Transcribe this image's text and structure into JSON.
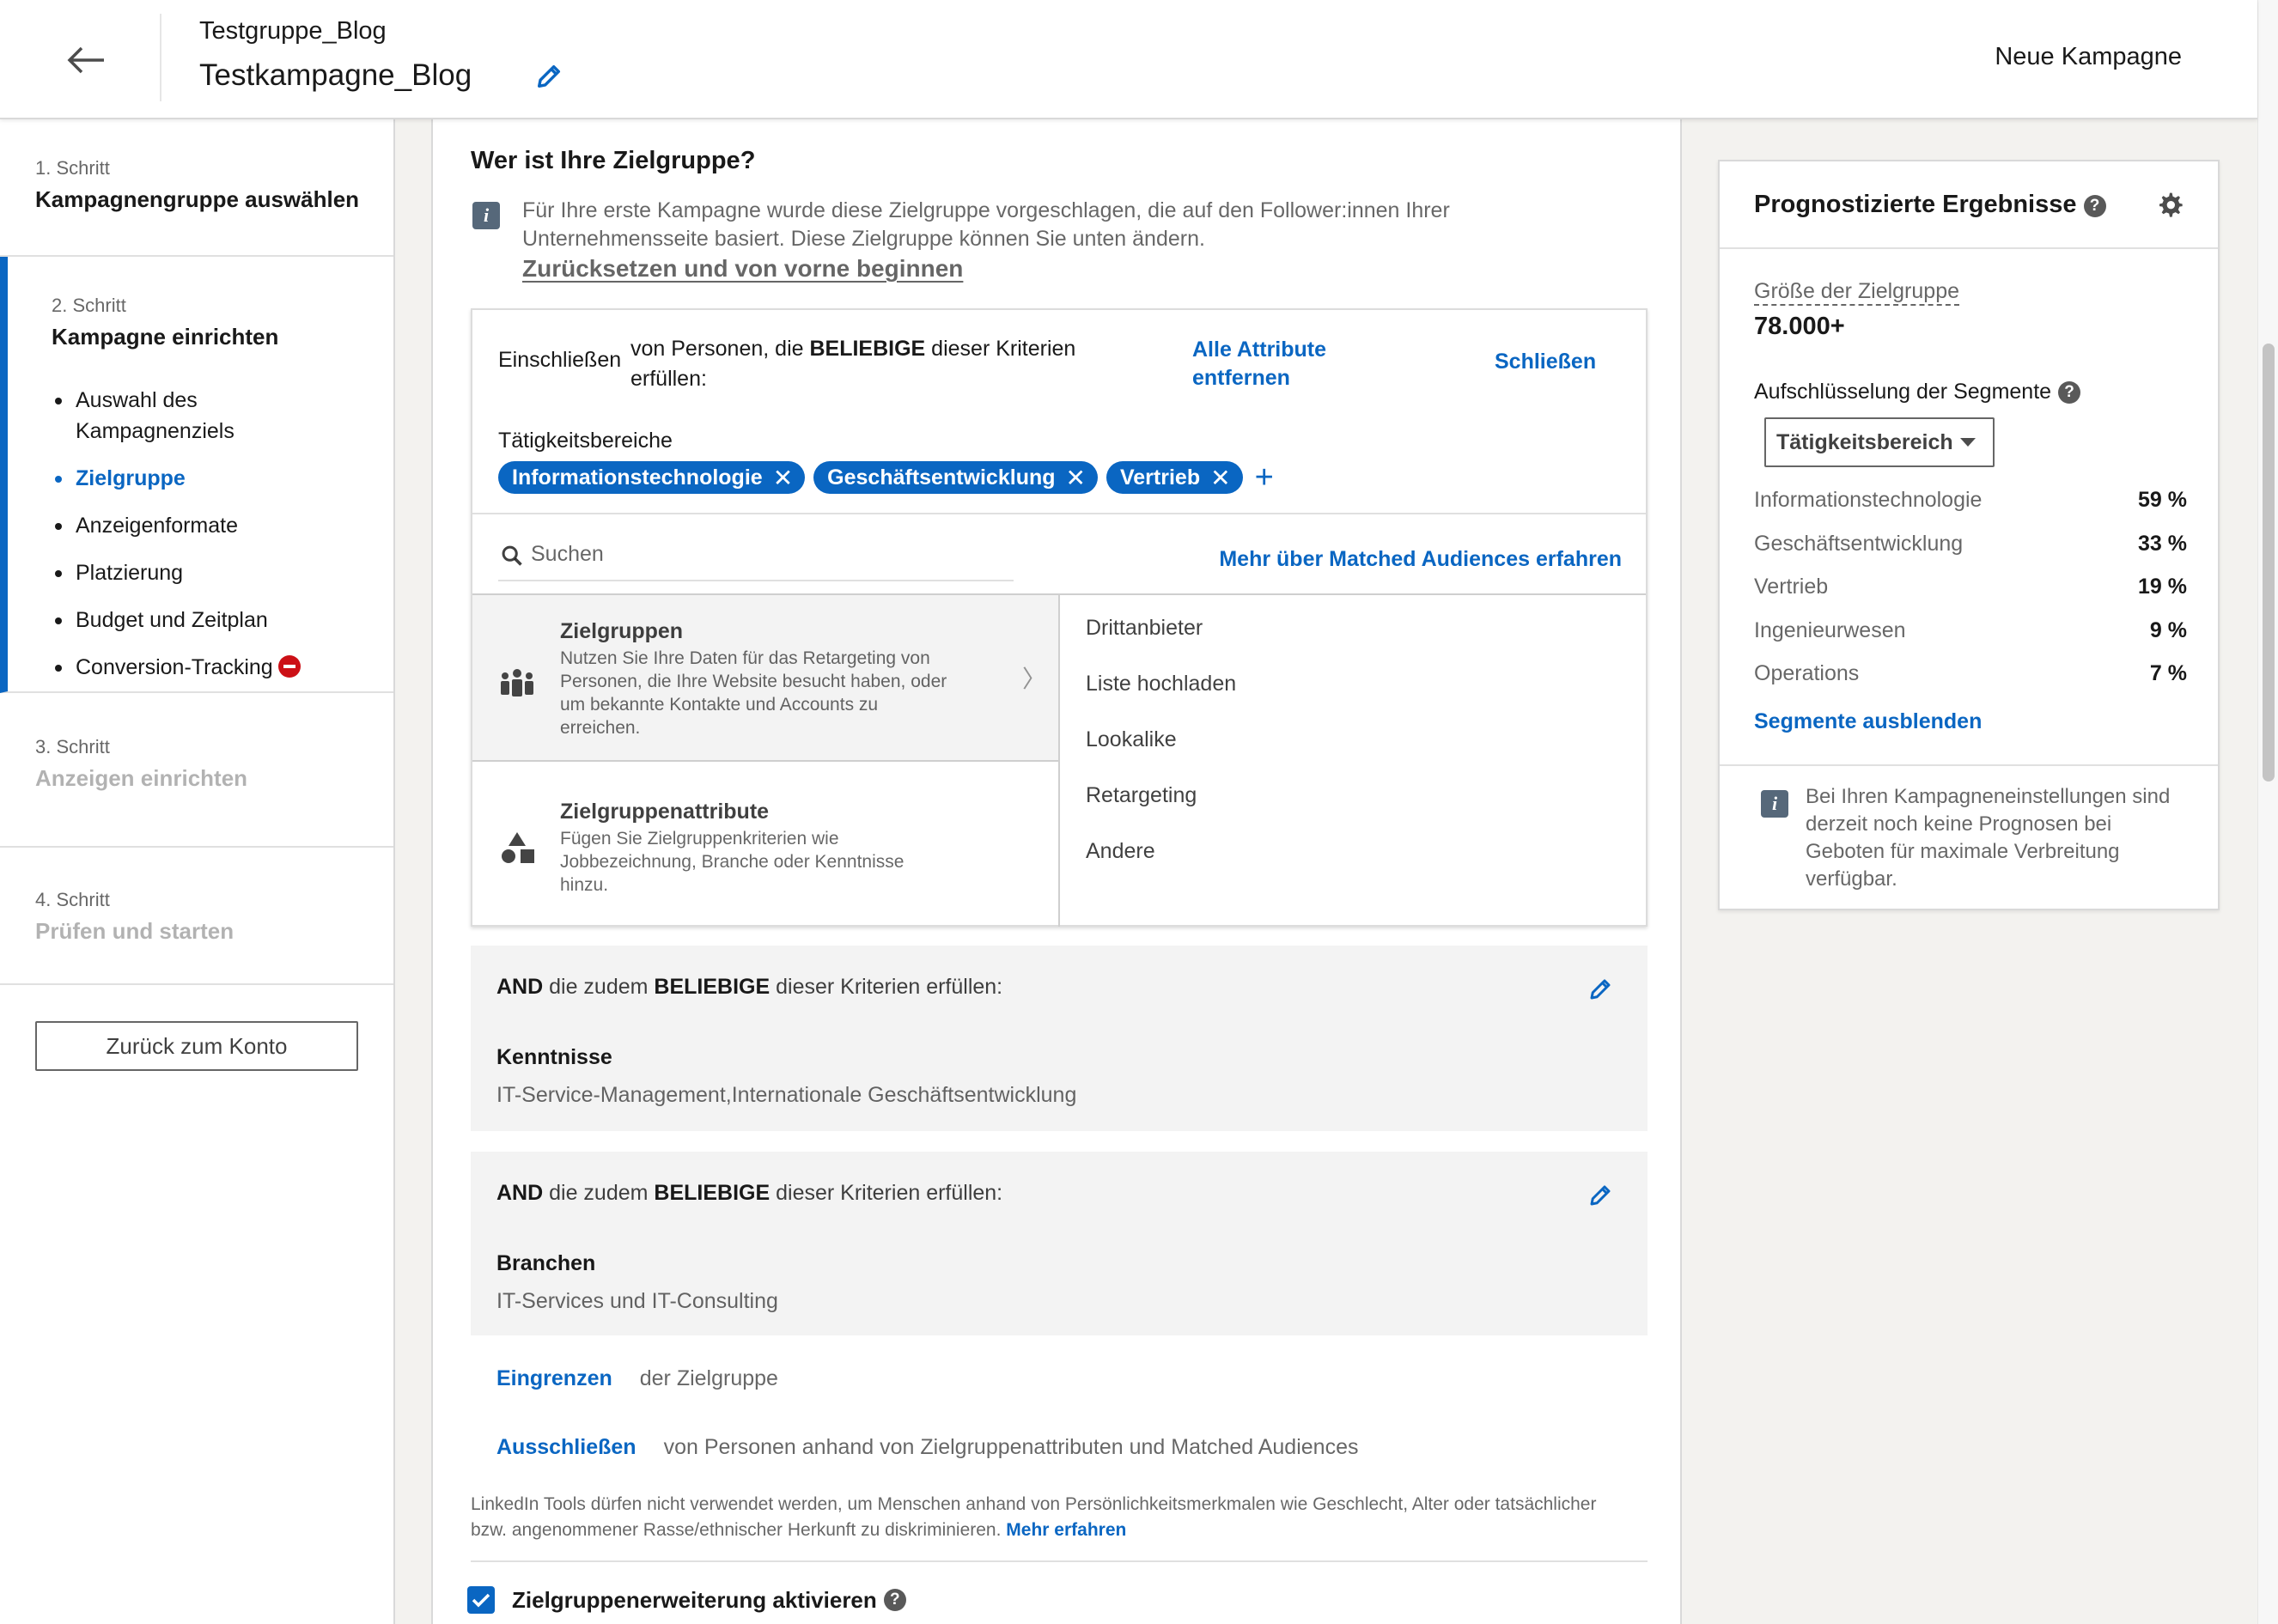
{
  "header": {
    "group_name": "Testgruppe_Blog",
    "campaign_name": "Testkampagne_Blog",
    "new_campaign": "Neue Kampagne"
  },
  "sidebar": {
    "step1": {
      "num": "1. Schritt",
      "title": "Kampagnengruppe auswählen"
    },
    "step2": {
      "num": "2. Schritt",
      "title": "Kampagne einrichten",
      "substeps": [
        "Auswahl des Kampagnenziels",
        "Zielgruppe",
        "Anzeigenformate",
        "Platzierung",
        "Budget und Zeitplan",
        "Conversion-Tracking"
      ]
    },
    "step3": {
      "num": "3. Schritt",
      "title": "Anzeigen einrichten"
    },
    "step4": {
      "num": "4. Schritt",
      "title": "Prüfen und starten"
    },
    "back_button": "Zurück zum Konto"
  },
  "main": {
    "section_title": "Wer ist Ihre Zielgruppe?",
    "info_text": "Für Ihre erste Kampagne wurde diese Zielgruppe vorgeschlagen, die auf den Follower:innen Ihrer Unternehmensseite basiert. Diese Zielgruppe können Sie unten ändern.",
    "reset_link": "Zurücksetzen und von vorne beginnen",
    "include": {
      "label": "Einschließen",
      "desc_pre": "von Personen, die ",
      "desc_bold": "BELIEBIGE",
      "desc_post": " dieser Kriterien erfüllen:",
      "remove_all": "Alle Attribute entfernen",
      "close": "Schließen",
      "category": "Tätigkeitsbereiche",
      "chips": [
        "Informationstechnologie",
        "Geschäftsentwicklung",
        "Vertrieb"
      ],
      "search_placeholder": "Suchen",
      "matched_link": "Mehr über Matched Audiences erfahren",
      "options": [
        {
          "title": "Zielgruppen",
          "desc": "Nutzen Sie Ihre Daten für das Retargeting von Personen, die Ihre Website besucht haben, oder um bekannte Kontakte und Accounts zu erreichen."
        },
        {
          "title": "Zielgruppenattribute",
          "desc": "Fügen Sie Zielgruppenkriterien wie Jobbezeichnung, Branche oder Kenntnisse hinzu."
        }
      ],
      "sub_options": [
        "Drittanbieter",
        "Liste hochladen",
        "Lookalike",
        "Retargeting",
        "Andere"
      ]
    },
    "and_blocks": [
      {
        "and": "AND",
        "mid": " die zudem ",
        "bold": "BELIEBIGE",
        "post": " dieser Kriterien erfüllen:",
        "category": "Kenntnisse",
        "value": "IT-Service-Management,Internationale Geschäftsentwicklung"
      },
      {
        "and": "AND",
        "mid": " die zudem ",
        "bold": "BELIEBIGE",
        "post": " dieser Kriterien erfüllen:",
        "category": "Branchen",
        "value": "IT-Services und IT-Consulting"
      }
    ],
    "narrow": {
      "link": "Eingrenzen",
      "text": "der Zielgruppe"
    },
    "exclude": {
      "link": "Ausschließen",
      "text": "von Personen anhand von Zielgruppenattributen und Matched Audiences"
    },
    "disclaimer": "LinkedIn Tools dürfen nicht verwendet werden, um Menschen anhand von Persönlichkeitsmerkmalen wie Geschlecht, Alter oder tatsächlicher bzw. angenommener Rasse/ethnischer Herkunft zu diskriminieren.",
    "disclaimer_link": "Mehr erfahren",
    "expansion_label": "Zielgruppenerweiterung aktivieren",
    "expansion_checked": true
  },
  "forecast": {
    "title": "Prognostizierte Ergebnisse",
    "audience_size_label": "Größe der Zielgruppe",
    "audience_size": "78.000+",
    "segment_title": "Aufschlüsselung der Segmente",
    "segment_select": "Tätigkeitsbereich",
    "segments": [
      {
        "name": "Informationstechnologie",
        "pct": "59 %"
      },
      {
        "name": "Geschäftsentwicklung",
        "pct": "33 %"
      },
      {
        "name": "Vertrieb",
        "pct": "19 %"
      },
      {
        "name": "Ingenieurwesen",
        "pct": "9 %"
      },
      {
        "name": "Operations",
        "pct": "7 %"
      }
    ],
    "hide_segments": "Segmente ausblenden",
    "note": "Bei Ihren Kampagneneinstellungen sind derzeit noch keine Prognosen bei Geboten für maximale Verbreitung verfügbar."
  },
  "colors": {
    "accent": "#0a66c2",
    "error": "#cc1016",
    "background": "#f3f2ef"
  },
  "icons": [
    "back-arrow-icon",
    "pencil-icon",
    "info-icon",
    "close-icon",
    "plus-icon",
    "search-icon",
    "people-group-icon",
    "shapes-icon",
    "chevron-right-icon",
    "help-icon",
    "gear-icon",
    "no-entry-icon",
    "checkmark-icon"
  ]
}
